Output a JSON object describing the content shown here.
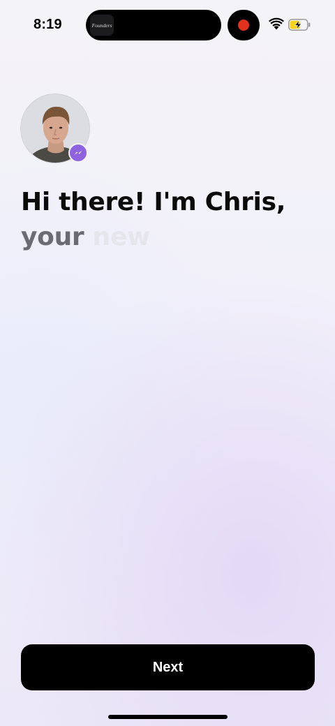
{
  "status_bar": {
    "time": "8:19",
    "island_app_label": "Founders",
    "record_color": "#e2321e",
    "battery_charging": true,
    "icons": [
      "wifi-icon",
      "battery-icon"
    ]
  },
  "assistant": {
    "avatar_icon": "user-avatar",
    "badge_icon": "messenger-icon",
    "badge_color": "#8f63e0",
    "greeting": "Hi there! I'm Chris,",
    "typing_words": [
      "your",
      "new"
    ]
  },
  "footer": {
    "next_label": "Next"
  }
}
